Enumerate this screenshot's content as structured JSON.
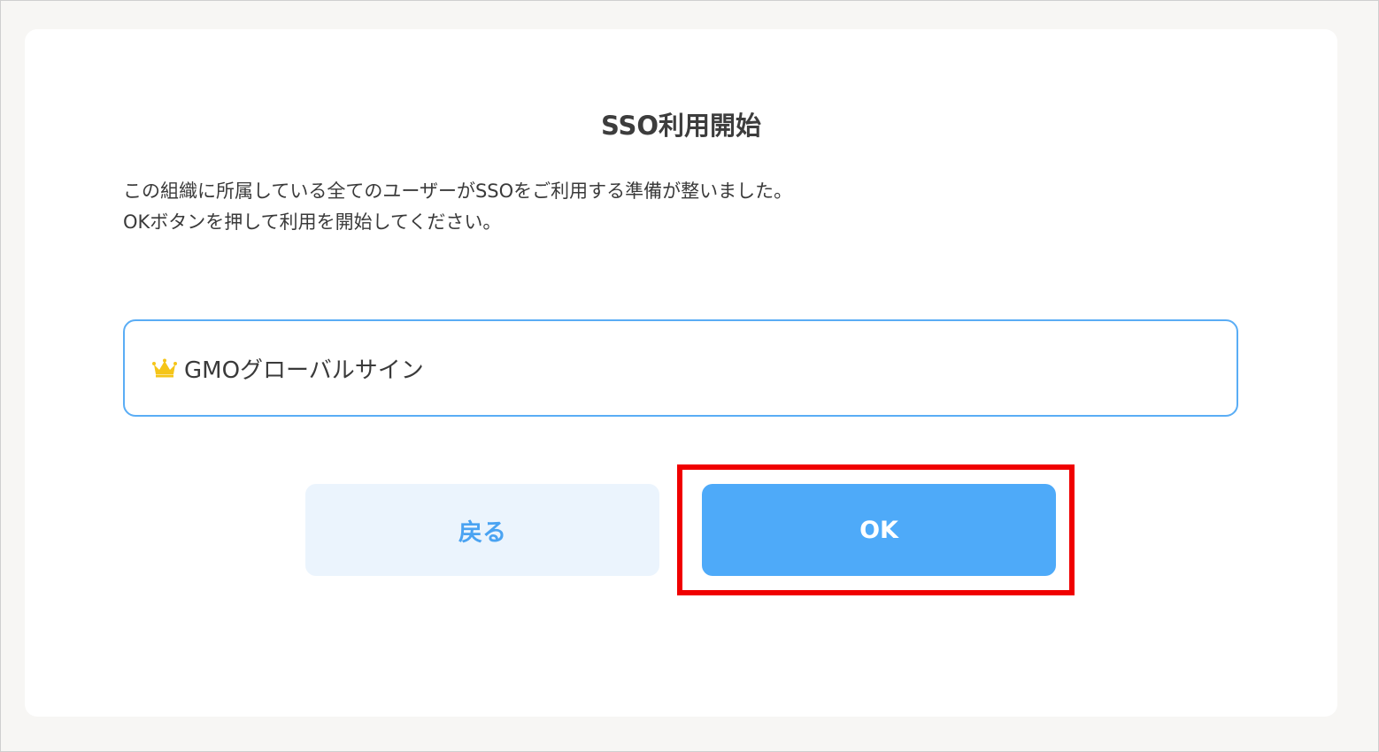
{
  "dialog": {
    "title": "SSO利用開始",
    "description_line1": "この組織に所属している全てのユーザーがSSOをご利用する準備が整いました。",
    "description_line2": "OKボタンを押して利用を開始してください。"
  },
  "organization": {
    "icon": "crown-icon",
    "name": "GMOグローバルサイン"
  },
  "buttons": {
    "back_label": "戻る",
    "ok_label": "OK"
  },
  "colors": {
    "accent": "#4eaaf9",
    "back_button_bg": "#ebf4fd",
    "highlight": "#f00000",
    "crown": "#f5c518"
  }
}
